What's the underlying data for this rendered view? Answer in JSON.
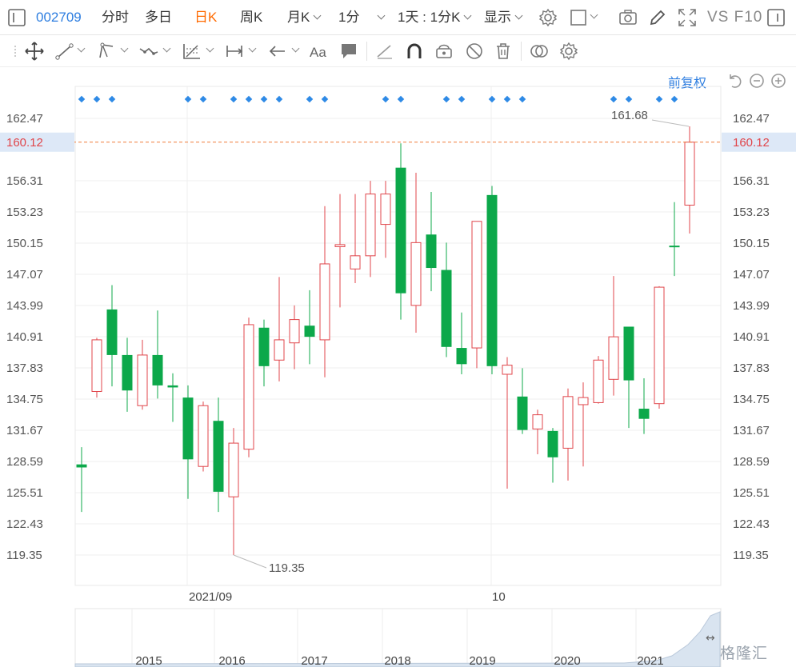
{
  "toolbar": {
    "stock_code": "002709",
    "items": [
      "分时",
      "多日",
      "日K",
      "周K",
      "月K",
      "1分",
      "1天 : 1分K",
      "显示"
    ],
    "active": "日K",
    "vs_f10": "VS F10"
  },
  "chart_controls": {
    "restore_label": "前复权"
  },
  "chart_data": {
    "type": "candlestick",
    "title": "",
    "xlabel": "",
    "ylabel": "",
    "ylim": [
      117.3,
      165.2
    ],
    "yticks": [
      162.47,
      160.12,
      156.31,
      153.23,
      150.15,
      147.07,
      143.99,
      140.91,
      137.83,
      134.75,
      131.67,
      128.59,
      125.51,
      122.43,
      119.35
    ],
    "current_price": 160.12,
    "xtick_labels": [
      "2021/09",
      "10"
    ],
    "annotations": [
      {
        "label": "161.68",
        "value": 161.68,
        "type": "high"
      },
      {
        "label": "119.35",
        "value": 119.35,
        "type": "low"
      }
    ],
    "colors": {
      "up": "#e0464b",
      "down": "#0ca84a",
      "price_line": "#f07d3a",
      "dots": "#2e8ae6"
    },
    "candles": [
      {
        "o": 128.3,
        "h": 130.0,
        "l": 123.6,
        "c": 128.0
      },
      {
        "o": 135.5,
        "h": 140.8,
        "l": 134.9,
        "c": 140.6
      },
      {
        "o": 143.6,
        "h": 146.0,
        "l": 136.0,
        "c": 139.1
      },
      {
        "o": 139.1,
        "h": 140.8,
        "l": 133.5,
        "c": 135.6
      },
      {
        "o": 134.1,
        "h": 140.6,
        "l": 133.7,
        "c": 139.1
      },
      {
        "o": 139.1,
        "h": 143.5,
        "l": 134.8,
        "c": 136.1
      },
      {
        "o": 136.1,
        "h": 137.3,
        "l": 132.5,
        "c": 135.9
      },
      {
        "o": 134.9,
        "h": 136.1,
        "l": 124.9,
        "c": 128.8
      },
      {
        "o": 128.1,
        "h": 134.5,
        "l": 127.6,
        "c": 134.1
      },
      {
        "o": 132.6,
        "h": 134.9,
        "l": 123.6,
        "c": 125.6
      },
      {
        "o": 125.1,
        "h": 131.9,
        "l": 119.35,
        "c": 130.4
      },
      {
        "o": 129.8,
        "h": 142.8,
        "l": 129.0,
        "c": 142.1
      },
      {
        "o": 141.8,
        "h": 142.6,
        "l": 136.0,
        "c": 138.0
      },
      {
        "o": 138.6,
        "h": 146.8,
        "l": 136.5,
        "c": 140.6
      },
      {
        "o": 140.3,
        "h": 144.0,
        "l": 137.7,
        "c": 142.6
      },
      {
        "o": 142.0,
        "h": 145.5,
        "l": 138.2,
        "c": 140.9
      },
      {
        "o": 140.6,
        "h": 153.8,
        "l": 136.9,
        "c": 148.1
      },
      {
        "o": 149.8,
        "h": 155.0,
        "l": 143.8,
        "c": 150.0
      },
      {
        "o": 147.6,
        "h": 155.0,
        "l": 146.2,
        "c": 148.9
      },
      {
        "o": 148.9,
        "h": 156.3,
        "l": 146.8,
        "c": 155.0
      },
      {
        "o": 152.0,
        "h": 156.3,
        "l": 148.7,
        "c": 155.0
      },
      {
        "o": 157.6,
        "h": 160.0,
        "l": 142.6,
        "c": 145.2
      },
      {
        "o": 144.0,
        "h": 157.1,
        "l": 141.3,
        "c": 150.2
      },
      {
        "o": 151.0,
        "h": 155.2,
        "l": 145.4,
        "c": 147.7
      },
      {
        "o": 147.5,
        "h": 150.2,
        "l": 138.9,
        "c": 139.9
      },
      {
        "o": 139.8,
        "h": 143.3,
        "l": 137.2,
        "c": 138.2
      },
      {
        "o": 139.8,
        "h": 152.3,
        "l": 137.8,
        "c": 152.3
      },
      {
        "o": 154.9,
        "h": 155.8,
        "l": 137.2,
        "c": 138.0
      },
      {
        "o": 137.2,
        "h": 138.9,
        "l": 125.9,
        "c": 138.1
      },
      {
        "o": 135.0,
        "h": 137.8,
        "l": 131.3,
        "c": 131.7
      },
      {
        "o": 131.8,
        "h": 133.7,
        "l": 129.3,
        "c": 133.2
      },
      {
        "o": 131.6,
        "h": 131.9,
        "l": 126.5,
        "c": 129.0
      },
      {
        "o": 129.9,
        "h": 135.8,
        "l": 126.7,
        "c": 135.0
      },
      {
        "o": 134.2,
        "h": 136.4,
        "l": 128.1,
        "c": 134.9
      },
      {
        "o": 134.4,
        "h": 139.0,
        "l": 134.3,
        "c": 138.6
      },
      {
        "o": 136.7,
        "h": 146.9,
        "l": 135.1,
        "c": 140.9
      },
      {
        "o": 141.9,
        "h": 141.9,
        "l": 131.9,
        "c": 136.6
      },
      {
        "o": 133.8,
        "h": 136.8,
        "l": 131.3,
        "c": 132.8
      },
      {
        "o": 134.3,
        "h": 145.9,
        "l": 133.8,
        "c": 145.8
      },
      {
        "o": 149.9,
        "h": 154.2,
        "l": 146.9,
        "c": 149.8
      },
      {
        "o": 153.9,
        "h": 161.68,
        "l": 151.1,
        "c": 160.12
      }
    ],
    "event_dots": [
      1,
      2,
      3,
      8,
      9,
      11,
      12,
      13,
      14,
      16,
      17,
      21,
      22,
      25,
      26,
      28,
      29,
      30,
      36,
      37,
      39,
      40
    ],
    "navigator": {
      "year_labels": [
        "2015",
        "2016",
        "2017",
        "2018",
        "2019",
        "2020",
        "2021"
      ]
    }
  },
  "watermark": "格隆汇"
}
